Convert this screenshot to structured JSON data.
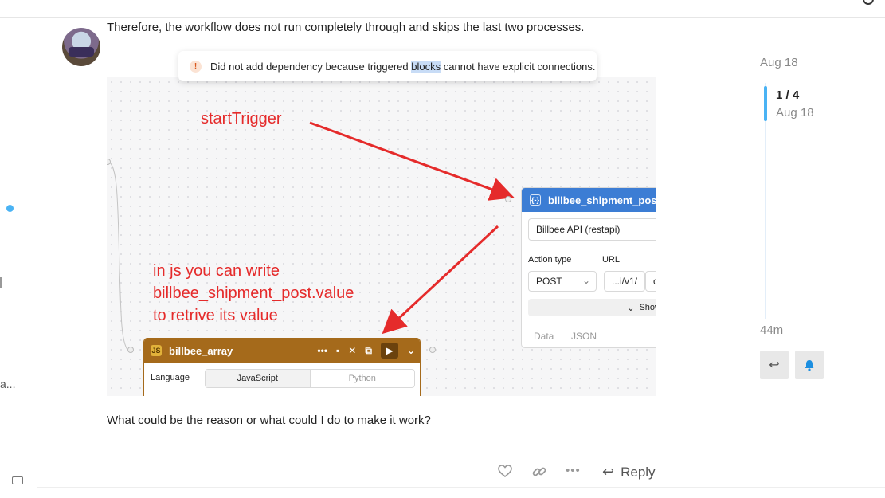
{
  "post": {
    "text1": "Therefore, the workflow does not run completely through and skips the last two processes.",
    "text2": "What could be the reason or what could I do to make it work?"
  },
  "left_rail": {
    "truncated_label": "a..."
  },
  "embed": {
    "toast": {
      "prefix": "Did not add dependency because triggered ",
      "highlight": "blocks",
      "suffix": " cannot have explicit connections.",
      "icon": "!"
    },
    "node_post": {
      "title": "billbee_shipment_post",
      "icon": "{-}",
      "resource": "Billbee API (restapi)",
      "action_type_label": "Action type",
      "url_label": "URL",
      "method": "POST",
      "method_chevron": "⌄",
      "url_value": "...i/v1/",
      "url_extra": "o",
      "show_label": "Show",
      "tabs": [
        "Data",
        "JSON"
      ]
    },
    "node_array": {
      "title": "billbee_array",
      "badge": "JS",
      "language_label": "Language",
      "languages": [
        "JavaScript",
        "Python"
      ],
      "header_buttons": [
        "•••",
        "▪",
        "✕",
        "⧉",
        "▶",
        "⌄"
      ]
    },
    "annotations": {
      "trigger": "startTrigger",
      "js_line1": "in js you can write",
      "js_line2": "billbee_shipment_post.value",
      "js_line3": "to retrive its value"
    },
    "colors": {
      "annotation": "#e52b2b",
      "node_blue": "#3c7dd4",
      "node_brown": "#a56a1b"
    }
  },
  "timeline": {
    "start_date": "Aug 18",
    "position": "1 / 4",
    "position_date": "Aug 18",
    "end_age": "44m"
  },
  "post_actions": {
    "like_icon": "heart-icon",
    "link_icon": "link-icon",
    "more_icon": "more-icon",
    "reply_label": "Reply"
  }
}
